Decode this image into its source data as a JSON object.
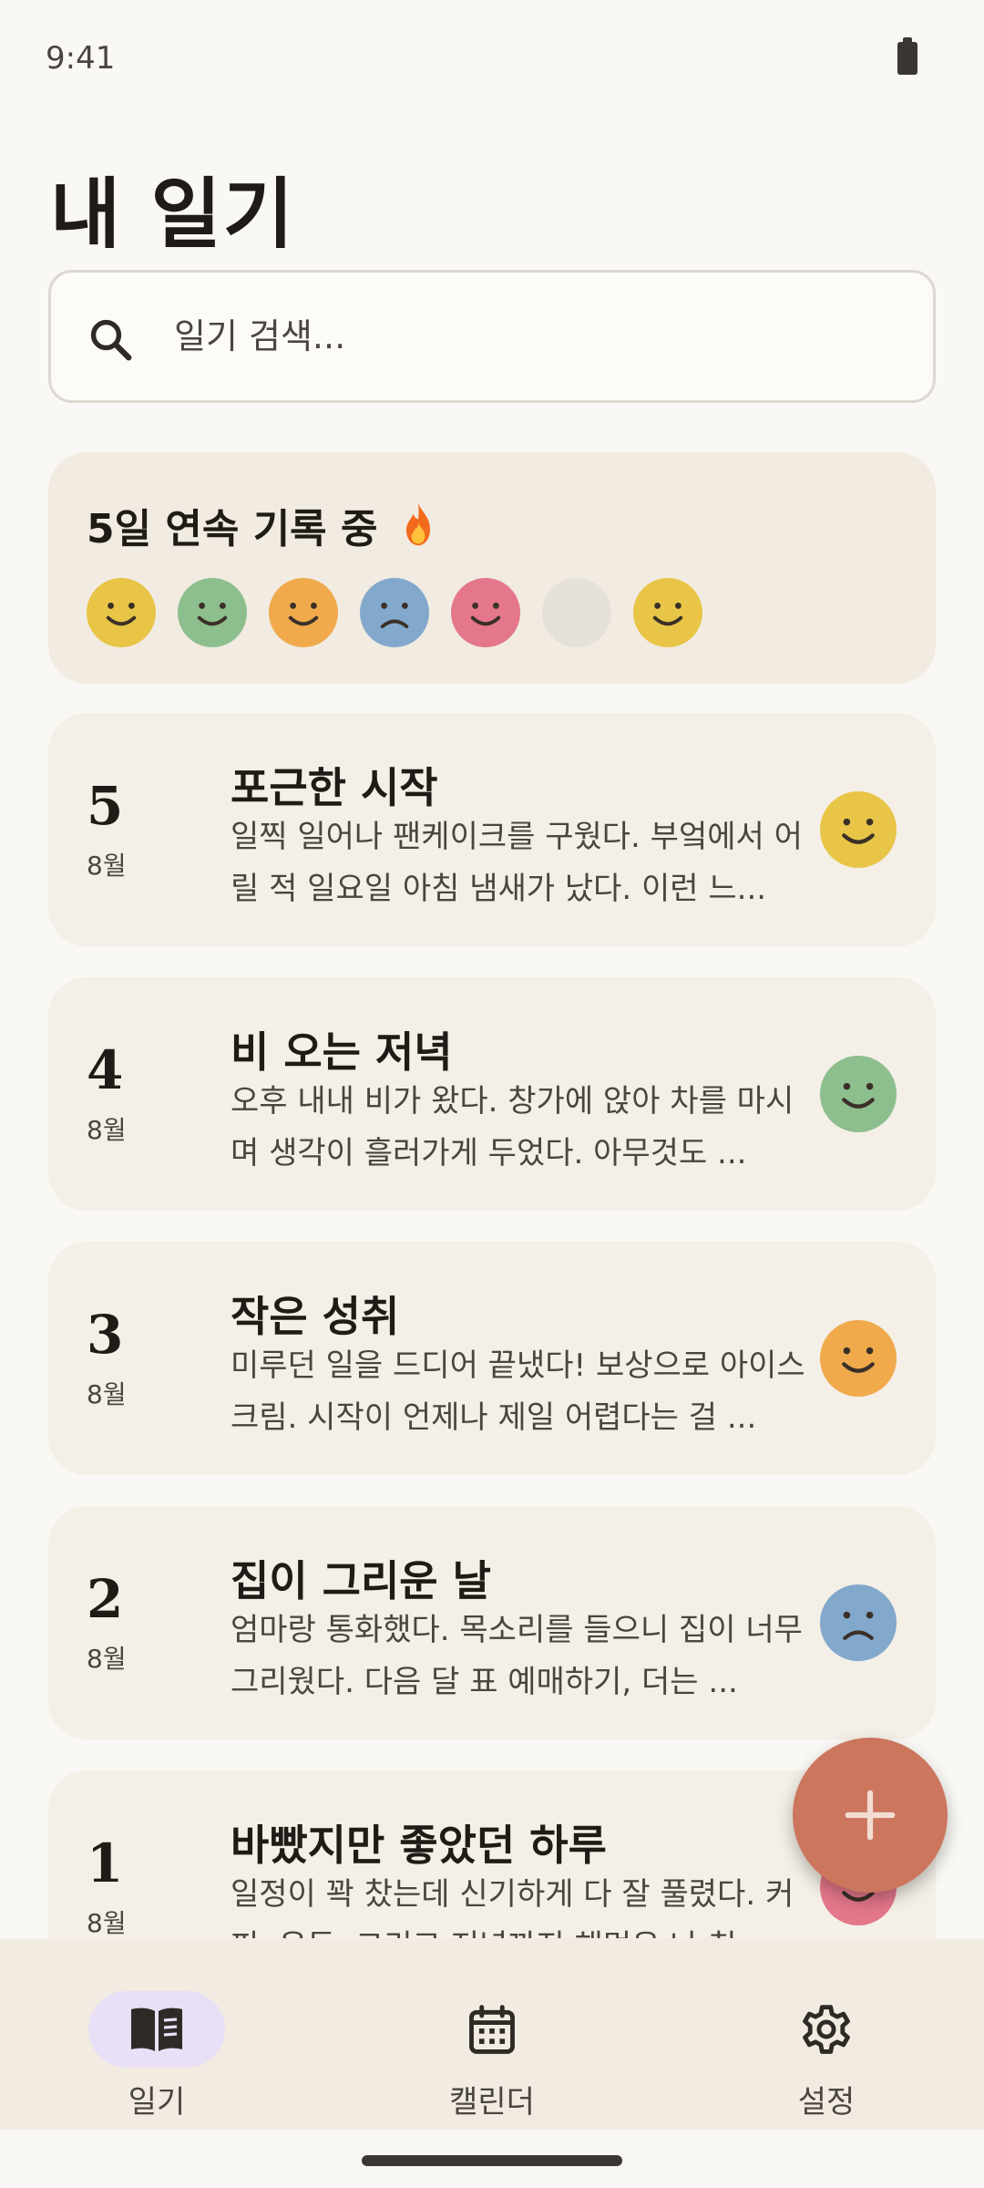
{
  "status_bar": {
    "time": "9:41"
  },
  "header": {
    "title": "내 일기"
  },
  "search": {
    "placeholder": "일기 검색..."
  },
  "streak": {
    "title": "5일 연속 기록 중",
    "days": [
      {
        "mood": "happy",
        "color": "#E8C547"
      },
      {
        "mood": "happy",
        "color": "#8DBE8E"
      },
      {
        "mood": "happy",
        "color": "#F0AA4C"
      },
      {
        "mood": "sad",
        "color": "#82A8CC"
      },
      {
        "mood": "happy",
        "color": "#E4778A"
      },
      {
        "mood": "none",
        "color": "#E6E1D8"
      },
      {
        "mood": "happy",
        "color": "#E8C547"
      }
    ]
  },
  "entries": [
    {
      "day": "5",
      "month": "8월",
      "title": "포근한 시작",
      "body": "일찍 일어나 팬케이크를 구웠다. 부엌에서 어릴 적 일요일 아침 냄새가 났다. 이런 느...",
      "mood": "happy",
      "mood_color": "#E8C547"
    },
    {
      "day": "4",
      "month": "8월",
      "title": "비 오는 저녁",
      "body": "오후 내내 비가 왔다. 창가에 앉아 차를 마시며 생각이 흘러가게 두었다. 아무것도 ...",
      "mood": "happy",
      "mood_color": "#8DBE8E"
    },
    {
      "day": "3",
      "month": "8월",
      "title": "작은 성취",
      "body": "미루던 일을 드디어 끝냈다! 보상으로 아이스크림. 시작이 언제나 제일 어렵다는 걸 ...",
      "mood": "happy",
      "mood_color": "#F0AA4C"
    },
    {
      "day": "2",
      "month": "8월",
      "title": "집이 그리운 날",
      "body": "엄마랑 통화했다. 목소리를 들으니 집이 너무 그리웠다. 다음 달 표 예매하기, 더는 ...",
      "mood": "sad",
      "mood_color": "#82A8CC"
    },
    {
      "day": "1",
      "month": "8월",
      "title": "바빴지만 좋았던 하루",
      "body": "일정이 꽉 찼는데 신기하게 다 잘 풀렸다. 커피, 운동, 그리고 저녁까지 해먹은 나 칭...",
      "mood": "happy",
      "mood_color": "#E4778A"
    }
  ],
  "fab": {
    "icon": "plus-icon",
    "color": "#CB765D"
  },
  "bottom_nav": {
    "items": [
      {
        "label": "일기",
        "icon": "book-icon",
        "active": true
      },
      {
        "label": "캘린더",
        "icon": "calendar-icon",
        "active": false
      },
      {
        "label": "설정",
        "icon": "gear-icon",
        "active": false
      }
    ]
  }
}
